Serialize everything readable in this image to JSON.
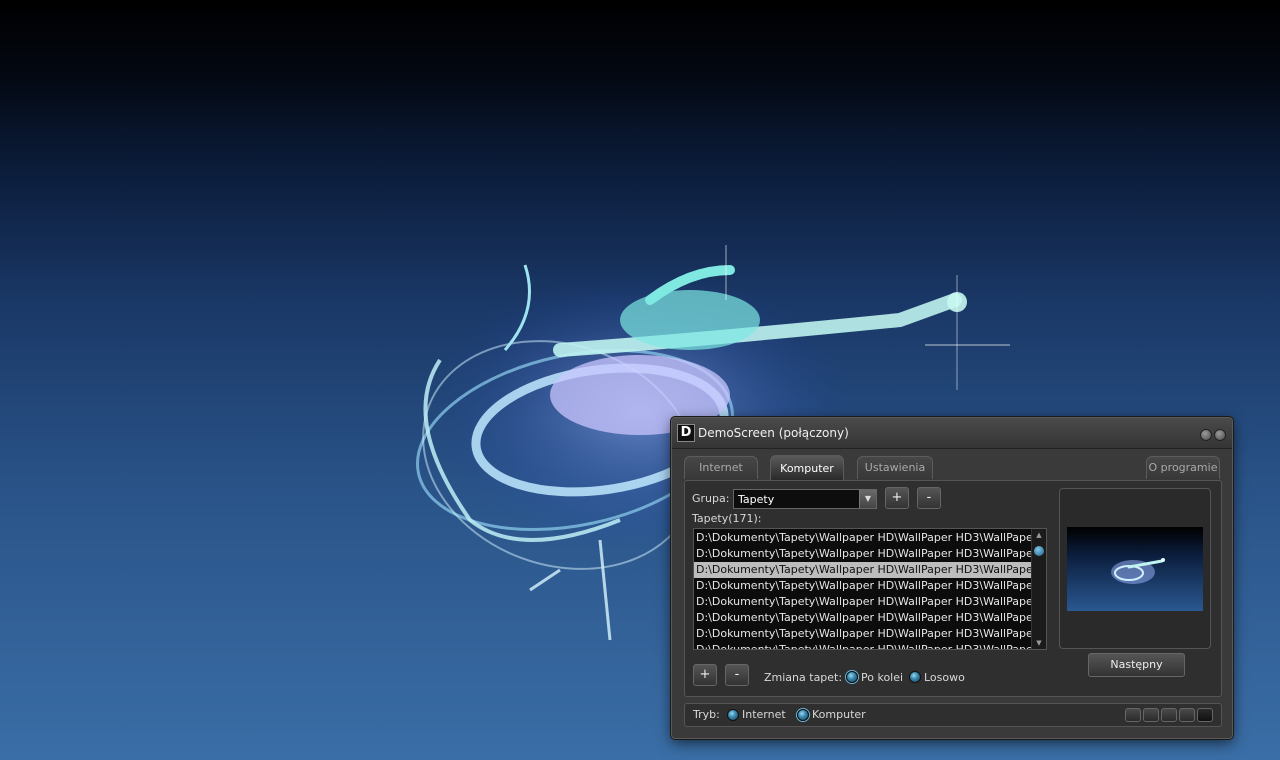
{
  "window": {
    "title": "DemoScreen (połączony)",
    "icon_letter": "D"
  },
  "tabs": [
    {
      "label": "Internet",
      "active": false
    },
    {
      "label": "Komputer",
      "active": true
    },
    {
      "label": "Ustawienia",
      "active": false
    },
    {
      "label": "O programie",
      "active": false
    }
  ],
  "group": {
    "label": "Grupa:",
    "selected": "Tapety",
    "add_label": "+",
    "remove_label": "-"
  },
  "list": {
    "header": "Tapety(171):",
    "items": [
      "D:\\Dokumenty\\Tapety\\Wallpaper HD\\WallPaper HD3\\WallPaper HD - ",
      "D:\\Dokumenty\\Tapety\\Wallpaper HD\\WallPaper HD3\\WallPaper HD - ",
      "D:\\Dokumenty\\Tapety\\Wallpaper HD\\WallPaper HD3\\WallPaper HD - ",
      "D:\\Dokumenty\\Tapety\\Wallpaper HD\\WallPaper HD3\\WallPaper HD - ",
      "D:\\Dokumenty\\Tapety\\Wallpaper HD\\WallPaper HD3\\WallPaper HD - ",
      "D:\\Dokumenty\\Tapety\\Wallpaper HD\\WallPaper HD3\\WallPaper HD - ",
      "D:\\Dokumenty\\Tapety\\Wallpaper HD\\WallPaper HD3\\WallPaper HD - ",
      "D:\\Dokumenty\\Tapety\\Wallpaper HD\\WallPaper HD3\\WallPaper HD - "
    ],
    "selected_index": 2,
    "add_label": "+",
    "remove_label": "-"
  },
  "change": {
    "label": "Zmiana tapet:",
    "options": [
      {
        "label": "Po kolei",
        "selected": true
      },
      {
        "label": "Losowo",
        "selected": false
      }
    ]
  },
  "next_button": "Następny",
  "mode": {
    "label": "Tryb:",
    "options": [
      {
        "label": "Internet",
        "selected": false
      },
      {
        "label": "Komputer",
        "selected": true
      }
    ]
  },
  "colors": {
    "accent": "#3a8ab0",
    "window_bg": "#3a3a3a",
    "selection": "#bdbdbd"
  }
}
